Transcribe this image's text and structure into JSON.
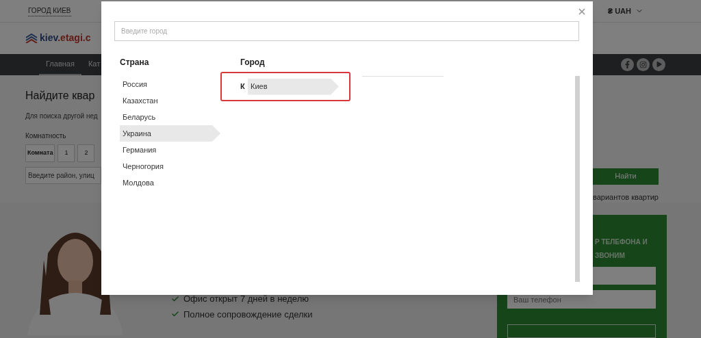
{
  "top_bar": {
    "city": "ГОРОД КИЕВ",
    "currency": "₴ UAH"
  },
  "logo": {
    "part_1": "kiev",
    "part_2": ".etagi.c"
  },
  "nav": {
    "items": [
      {
        "label": "Главная",
        "selected": true
      },
      {
        "label": "Кат",
        "selected": false
      }
    ]
  },
  "search": {
    "title": "Найдите квар",
    "subtitle": "Для поиска другой нед",
    "rooms_label": "Комнатность",
    "room_buttons": [
      "Комната",
      "1",
      "2"
    ],
    "address_placeholder": "Введите район, улиц",
    "find_button": "Найти",
    "results": "вариантов квартир"
  },
  "promo": {
    "features": [
      "Офис открыт 7 дней в неделю",
      "Полное сопровождение сделки"
    ]
  },
  "callback": {
    "heading_lines": [
      "Р ТЕЛЕФОНА И",
      "ЗВОНИМ"
    ],
    "phone_placeholder": "Ваш телефон"
  },
  "modal": {
    "search_placeholder": "Введите город",
    "country_heading": "Страна",
    "countries": [
      {
        "name": "Россия",
        "selected": false
      },
      {
        "name": "Казахстан",
        "selected": false
      },
      {
        "name": "Беларусь",
        "selected": false
      },
      {
        "name": "Украина",
        "selected": true
      },
      {
        "name": "Германия",
        "selected": false
      },
      {
        "name": "Черногория",
        "selected": false
      },
      {
        "name": "Молдова",
        "selected": false
      }
    ],
    "city_heading": "Город",
    "city_groups": [
      {
        "letter": "К",
        "cities": [
          {
            "name": "Киев",
            "selected": true
          }
        ]
      }
    ]
  }
}
